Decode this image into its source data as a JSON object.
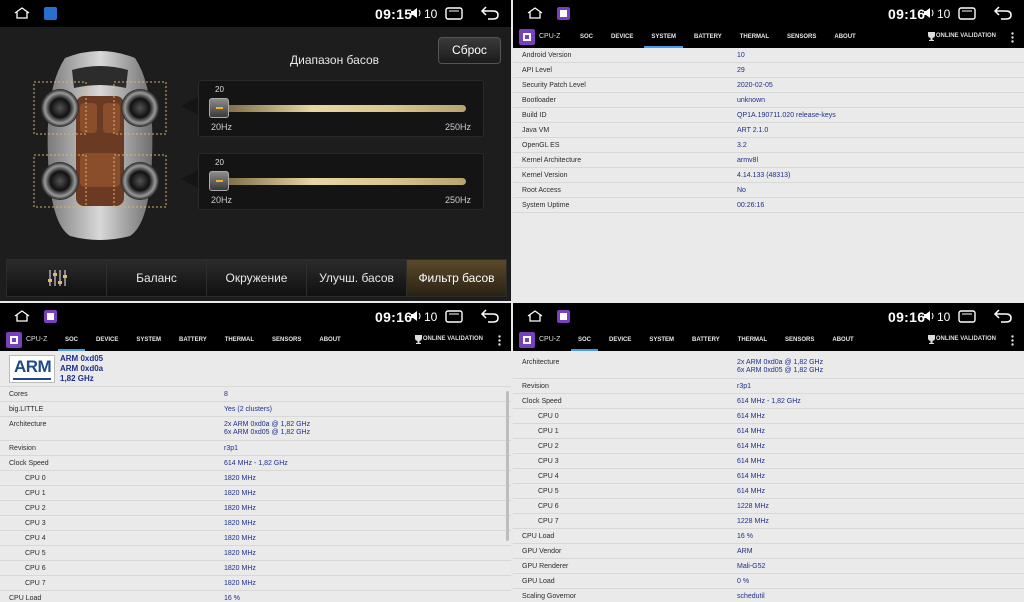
{
  "status": {
    "time_a": "09:15",
    "time_b": "09:16",
    "volume": "10"
  },
  "bass": {
    "title": "Диапазон басов",
    "reset_label": "Сброс",
    "slider1": {
      "value": "20",
      "min": "20Hz",
      "max": "250Hz",
      "level": 0.0
    },
    "slider2": {
      "value": "20",
      "min": "20Hz",
      "max": "250Hz",
      "level": 0.0
    },
    "tabs": [
      "Баланс",
      "Окружение",
      "Улучш. басов",
      "Фильтр басов"
    ]
  },
  "cpuz": {
    "app_name": "CPU-Z",
    "tabs": [
      "SOC",
      "DEVICE",
      "SYSTEM",
      "BATTERY",
      "THERMAL",
      "SENSORS",
      "ABOUT"
    ],
    "online_label": "ONLINE VALIDATION"
  },
  "system_tab": [
    {
      "k": "Android Version",
      "v": "10"
    },
    {
      "k": "API Level",
      "v": "29"
    },
    {
      "k": "Security Patch Level",
      "v": "2020-02-05"
    },
    {
      "k": "Bootloader",
      "v": "unknown"
    },
    {
      "k": "Build ID",
      "v": "QP1A.190711.020 release-keys"
    },
    {
      "k": "Java VM",
      "v": "ART 2.1.0"
    },
    {
      "k": "OpenGL ES",
      "v": "3.2"
    },
    {
      "k": "Kernel Architecture",
      "v": "armv8l"
    },
    {
      "k": "Kernel Version",
      "v": "4.14.133 (48313)"
    },
    {
      "k": "Root Access",
      "v": "No"
    },
    {
      "k": "System Uptime",
      "v": "00:26:16"
    }
  ],
  "soc_tab": {
    "logo_text": "ARM",
    "header_lines": [
      "ARM 0xd05",
      "ARM 0xd0a",
      "1,82 GHz"
    ],
    "rows": [
      {
        "k": "Cores",
        "v": "8"
      },
      {
        "k": "big.LITTLE",
        "v": "Yes (2 clusters)"
      },
      {
        "k": "Architecture",
        "v": "2x ARM 0xd0a @ 1,82 GHz\n6x ARM 0xd05 @ 1,82 GHz",
        "tall": true
      },
      {
        "k": "Revision",
        "v": "r3p1"
      },
      {
        "k": "Clock Speed",
        "v": "614 MHz - 1,82 GHz"
      },
      {
        "k": "CPU 0",
        "v": "1820 MHz",
        "sub": true
      },
      {
        "k": "CPU 1",
        "v": "1820 MHz",
        "sub": true
      },
      {
        "k": "CPU 2",
        "v": "1820 MHz",
        "sub": true
      },
      {
        "k": "CPU 3",
        "v": "1820 MHz",
        "sub": true
      },
      {
        "k": "CPU 4",
        "v": "1820 MHz",
        "sub": true
      },
      {
        "k": "CPU 5",
        "v": "1820 MHz",
        "sub": true
      },
      {
        "k": "CPU 6",
        "v": "1820 MHz",
        "sub": true
      },
      {
        "k": "CPU 7",
        "v": "1820 MHz",
        "sub": true
      },
      {
        "k": "CPU Load",
        "v": "16 %"
      }
    ]
  },
  "soc_tab_scrolled": [
    {
      "k": "Architecture",
      "v": "2x ARM 0xd0a @ 1,82 GHz\n6x ARM 0xd05 @ 1,82 GHz",
      "tall": true
    },
    {
      "k": "Revision",
      "v": "r3p1"
    },
    {
      "k": "Clock Speed",
      "v": "614 MHz - 1,82 GHz"
    },
    {
      "k": "CPU 0",
      "v": "614 MHz",
      "sub": true
    },
    {
      "k": "CPU 1",
      "v": "614 MHz",
      "sub": true
    },
    {
      "k": "CPU 2",
      "v": "614 MHz",
      "sub": true
    },
    {
      "k": "CPU 3",
      "v": "614 MHz",
      "sub": true
    },
    {
      "k": "CPU 4",
      "v": "614 MHz",
      "sub": true
    },
    {
      "k": "CPU 5",
      "v": "614 MHz",
      "sub": true
    },
    {
      "k": "CPU 6",
      "v": "1228 MHz",
      "sub": true
    },
    {
      "k": "CPU 7",
      "v": "1228 MHz",
      "sub": true
    },
    {
      "k": "CPU Load",
      "v": "16 %"
    },
    {
      "k": "GPU Vendor",
      "v": "ARM"
    },
    {
      "k": "GPU Renderer",
      "v": "Mali-G52"
    },
    {
      "k": "GPU Load",
      "v": "0 %"
    },
    {
      "k": "Scaling Governor",
      "v": "schedutil"
    }
  ],
  "colors": {
    "accent_blue": "#4a9be8",
    "value_text": "#1e2f8a",
    "slider_gold": "#e6d6a2",
    "active_tab": "#5a4a2b"
  }
}
